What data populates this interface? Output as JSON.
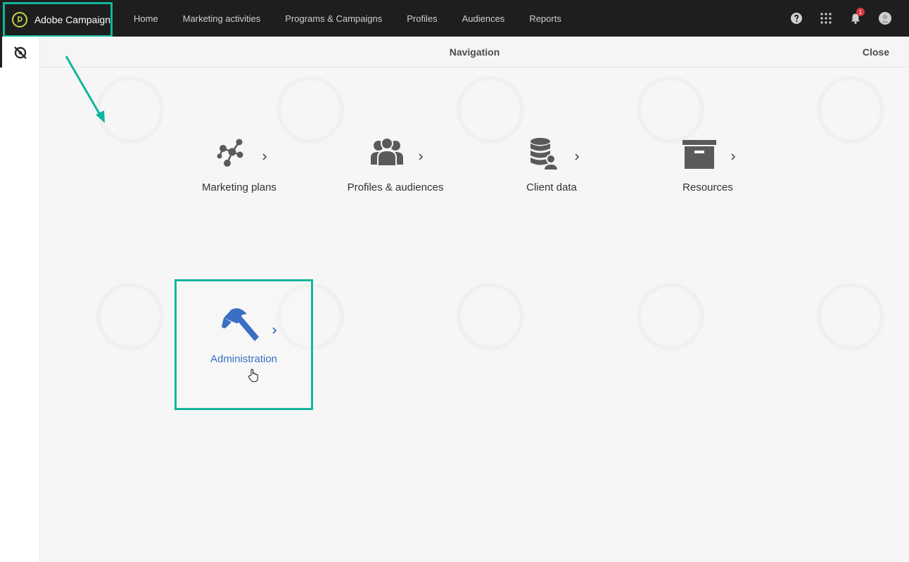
{
  "app": {
    "name": "Adobe Campaign"
  },
  "topnav": {
    "items": [
      {
        "label": "Home"
      },
      {
        "label": "Marketing activities"
      },
      {
        "label": "Programs & Campaigns"
      },
      {
        "label": "Profiles"
      },
      {
        "label": "Audiences"
      },
      {
        "label": "Reports"
      }
    ],
    "notification_count": "1",
    "icons": [
      "help-icon",
      "apps-grid-icon",
      "bell-icon",
      "user-avatar-icon"
    ]
  },
  "leftrail": {
    "icon": "navigation-toggle-icon"
  },
  "panel": {
    "title": "Navigation",
    "close_label": "Close"
  },
  "nav_items": [
    {
      "label": "Marketing plans",
      "icon": "marketing-plans-icon"
    },
    {
      "label": "Profiles & audiences",
      "icon": "profiles-icon"
    },
    {
      "label": "Client data",
      "icon": "client-data-icon"
    },
    {
      "label": "Resources",
      "icon": "resources-box-icon"
    },
    {
      "label": "Administration",
      "icon": "hammer-icon"
    }
  ],
  "colors": {
    "topbar": "#1e1e1e",
    "highlight": "#12b59c",
    "admin_text": "#3a6fc4",
    "icon_gray": "#5a5a5a",
    "logo_accent": "#c2d94b"
  }
}
